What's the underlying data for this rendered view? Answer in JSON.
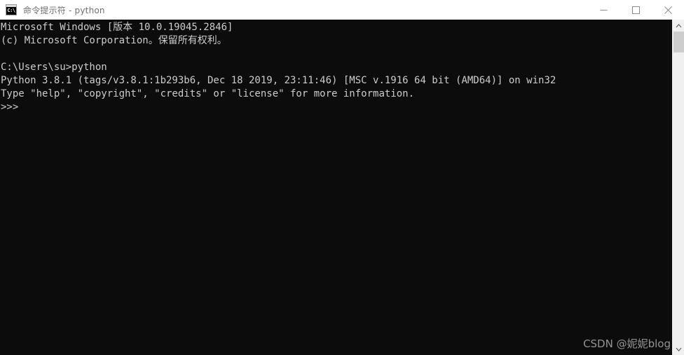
{
  "window": {
    "title": "命令提示符 - python",
    "icon_name": "command-prompt-icon",
    "icon_text": "C:\\",
    "background_color": "#0c0c0c",
    "titlebar_color": "#ffffff",
    "text_color": "#cccccc"
  },
  "controls": {
    "minimize_label": "最小化",
    "maximize_label": "最大化",
    "close_label": "关闭"
  },
  "console": {
    "lines": [
      "Microsoft Windows [版本 10.0.19045.2846]",
      "(c) Microsoft Corporation。保留所有权利。",
      "",
      "C:\\Users\\su>python",
      "Python 3.8.1 (tags/v3.8.1:1b293b6, Dec 18 2019, 23:11:46) [MSC v.1916 64 bit (AMD64)] on win32",
      "Type \"help\", \"copyright\", \"credits\" or \"license\" for more information.",
      ">>>"
    ],
    "text": "Microsoft Windows [版本 10.0.19045.2846]\n(c) Microsoft Corporation。保留所有权利。\n\nC:\\Users\\su>python\nPython 3.8.1 (tags/v3.8.1:1b293b6, Dec 18 2019, 23:11:46) [MSC v.1916 64 bit (AMD64)] on win32\nType \"help\", \"copyright\", \"credits\" or \"license\" for more information.\n>>>",
    "prompt": ">>>"
  },
  "watermark": {
    "text": "CSDN @妮妮blog"
  },
  "scrollbar": {
    "up_glyph": "︿",
    "down_glyph": "﹀"
  }
}
